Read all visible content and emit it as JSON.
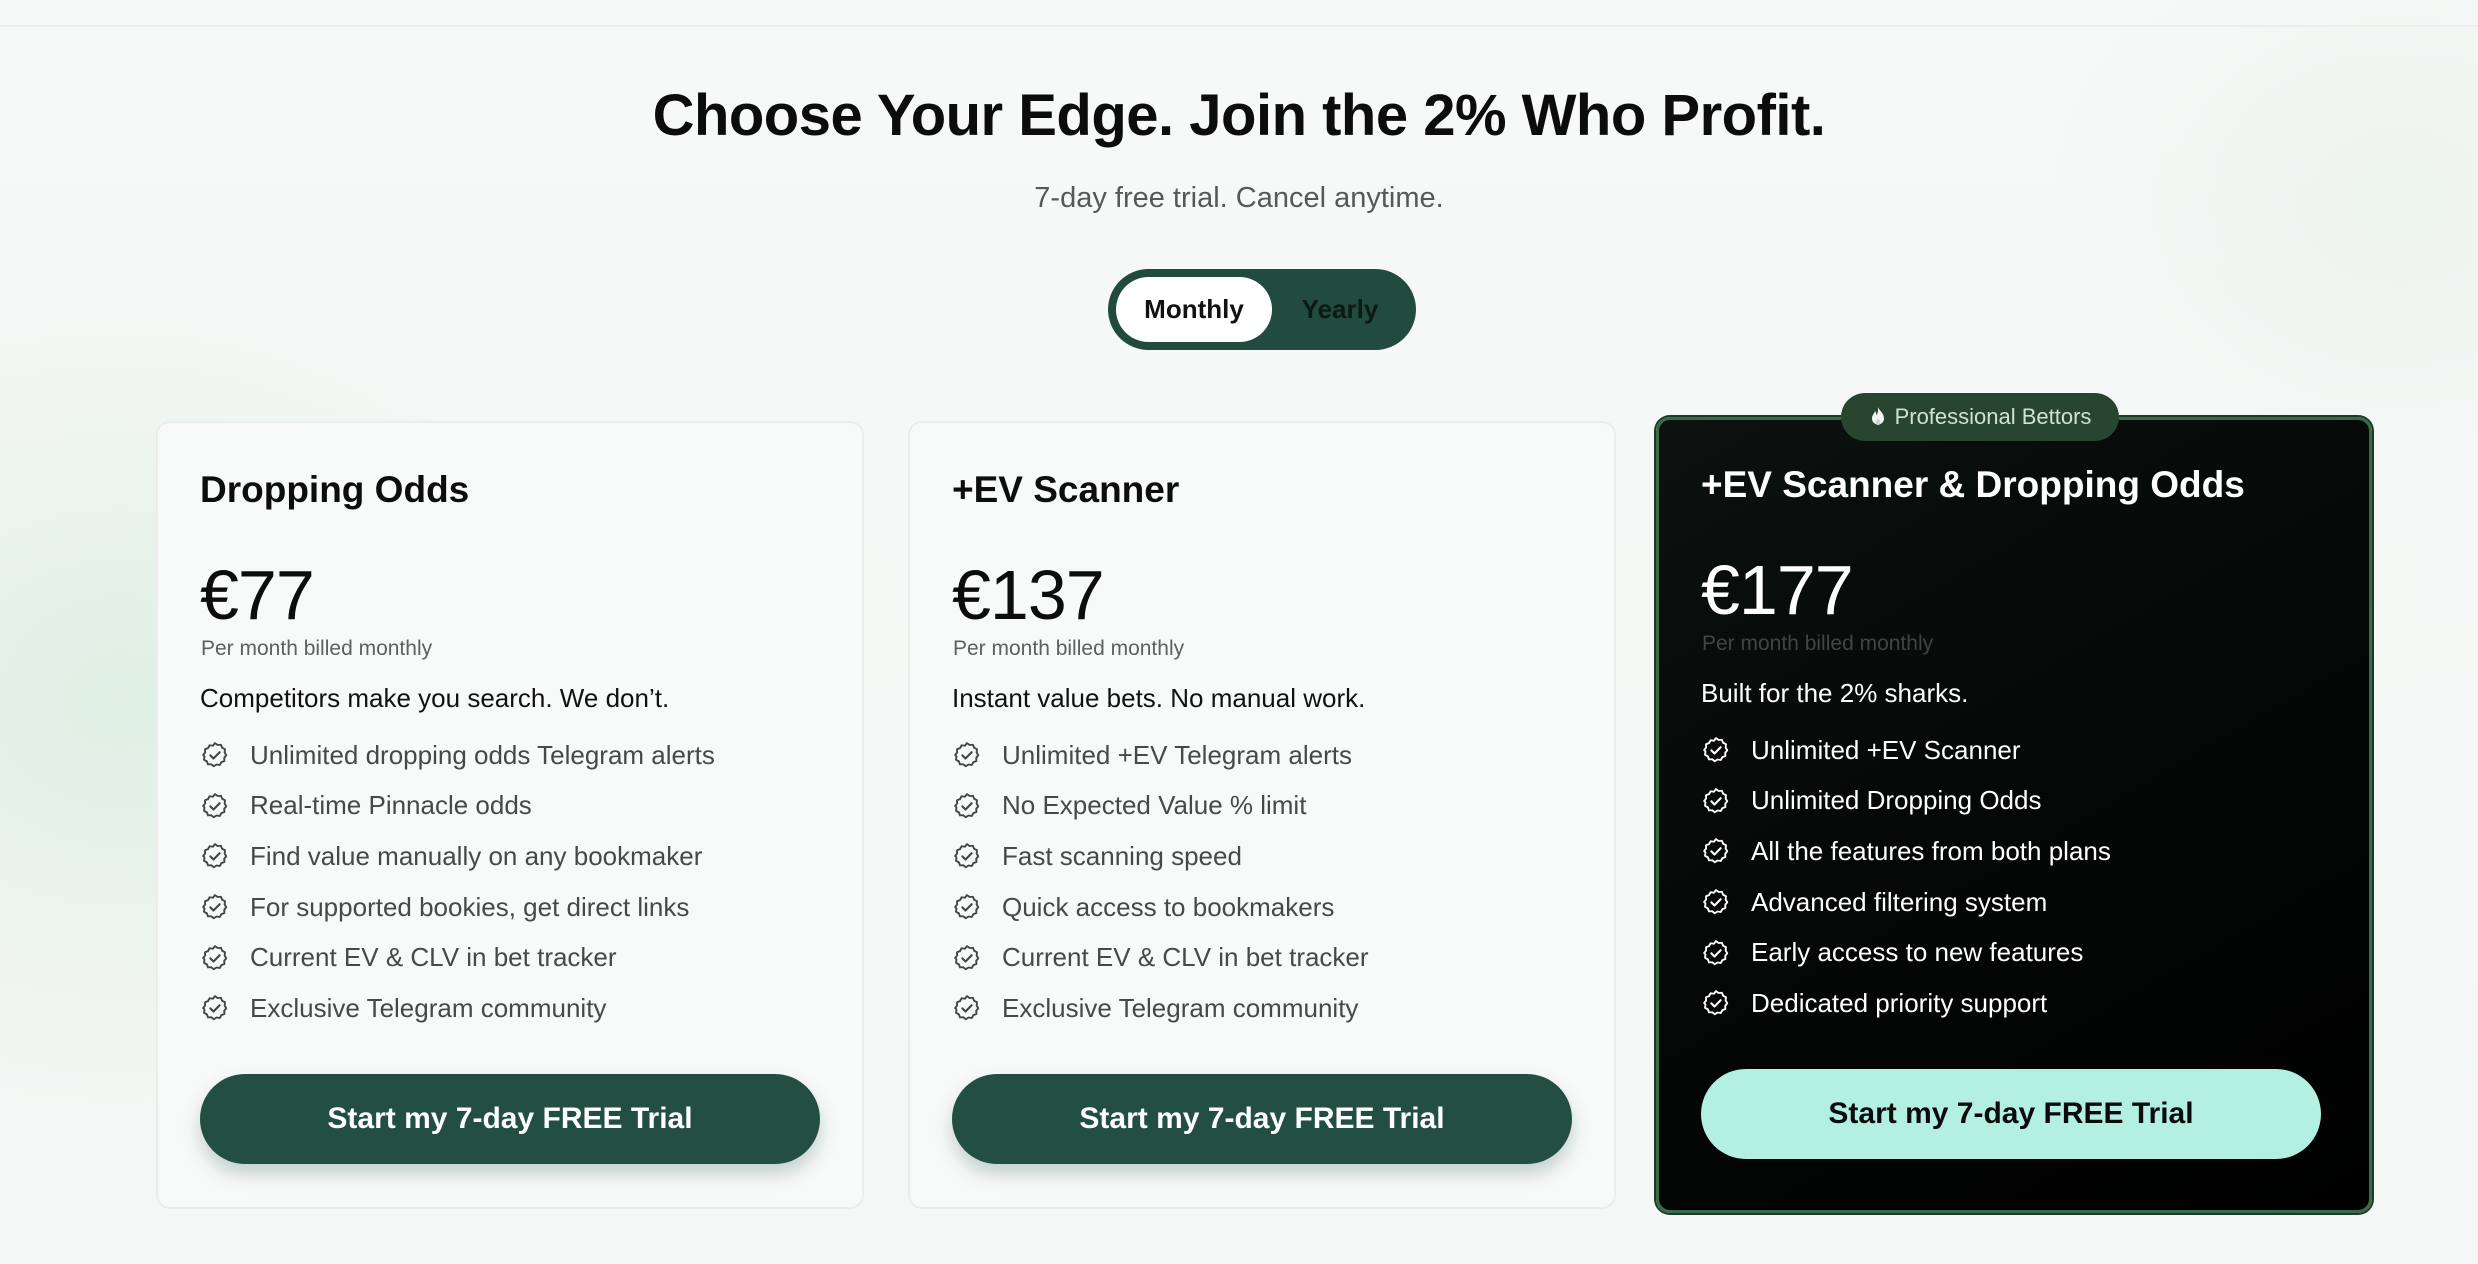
{
  "header": {
    "title": "Choose Your Edge. Join the 2% Who Profit.",
    "subtitle": "7-day free trial. Cancel anytime."
  },
  "billing_toggle": {
    "options": [
      "Monthly",
      "Yearly"
    ],
    "selected": "Monthly"
  },
  "plans": [
    {
      "name": "Dropping Odds",
      "price": "€77",
      "period": "Per month billed monthly",
      "tagline": "Competitors make you search. We don’t.",
      "features": [
        "Unlimited dropping odds Telegram alerts",
        "Real-time Pinnacle odds",
        "Find value manually on any bookmaker",
        "For supported bookies, get direct links",
        "Current EV & CLV in bet tracker",
        "Exclusive Telegram community"
      ],
      "cta": "Start my 7-day FREE Trial"
    },
    {
      "name": "+EV Scanner",
      "price": "€137",
      "period": "Per month billed monthly",
      "tagline": "Instant value bets. No manual work.",
      "features": [
        "Unlimited +EV Telegram alerts",
        "No Expected Value % limit",
        "Fast scanning speed",
        "Quick access to bookmakers",
        "Current EV & CLV in bet tracker",
        "Exclusive Telegram community"
      ],
      "cta": "Start my 7-day FREE Trial"
    },
    {
      "badge": "Professional Bettors",
      "name": "+EV Scanner & Dropping Odds",
      "price": "€177",
      "period": "Per month billed monthly",
      "tagline": "Built for the 2% sharks.",
      "features": [
        "Unlimited +EV Scanner",
        "Unlimited Dropping Odds",
        "All the features from both plans",
        "Advanced filtering system",
        "Early access to new features",
        "Dedicated priority support"
      ],
      "cta": "Start my 7-day FREE Trial"
    }
  ],
  "colors": {
    "brand_green": "#234e42",
    "cta_highlight": "#b3f0e1",
    "featured_card_bg": "#050807",
    "badge_bg": "#27452f"
  },
  "icons": {
    "feature": "check-badge-icon",
    "badge": "flame-icon"
  }
}
